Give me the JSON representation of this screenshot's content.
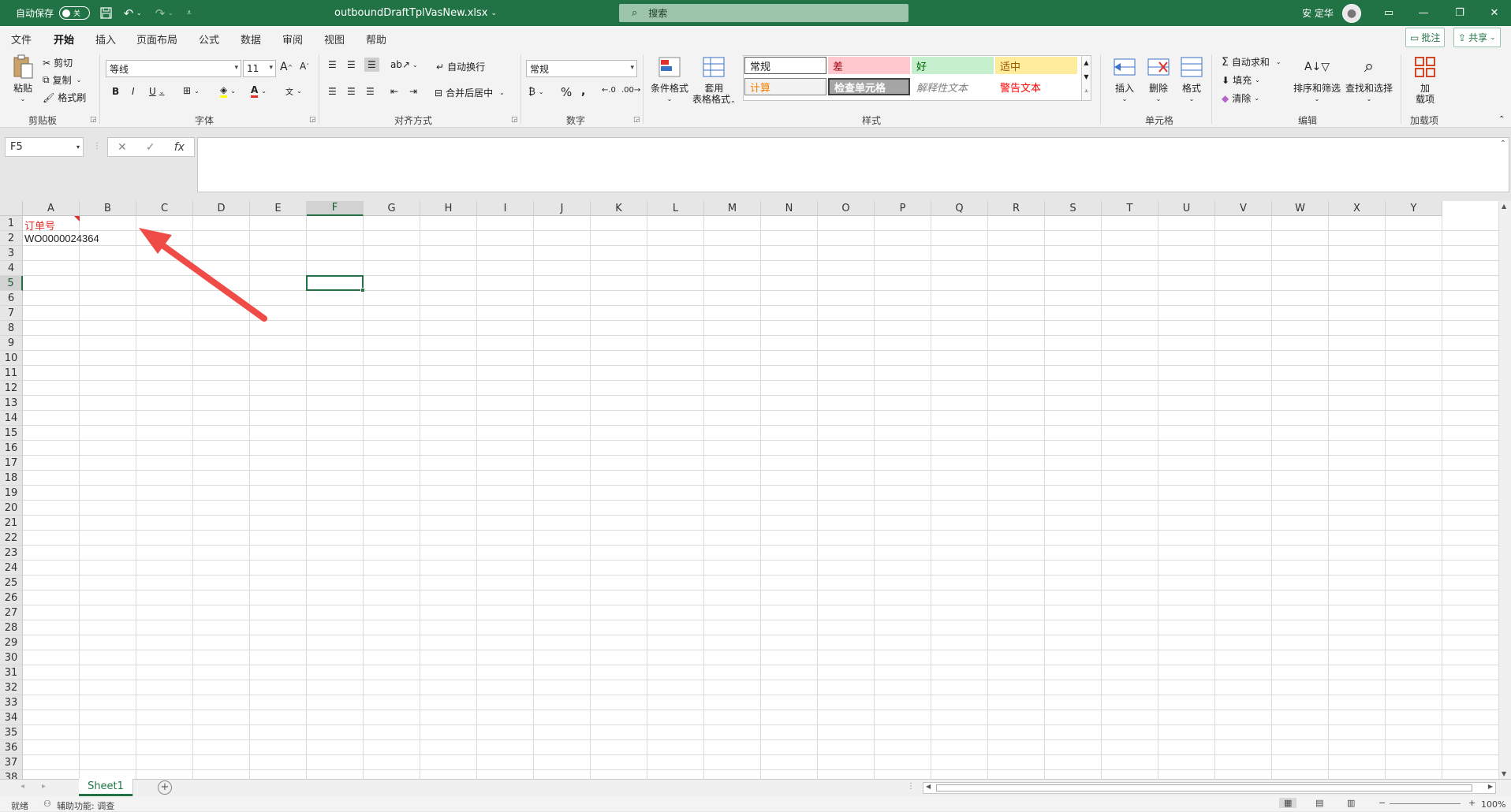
{
  "titlebar": {
    "autosave_label": "自动保存",
    "autosave_state": "关",
    "document_title": "outboundDraftTplVasNew.xlsx",
    "search_placeholder": "搜索",
    "user_name": "安 定华"
  },
  "ribbon_tabs": [
    "文件",
    "开始",
    "插入",
    "页面布局",
    "公式",
    "数据",
    "审阅",
    "视图",
    "帮助"
  ],
  "ribbon_actions": {
    "comments": "批注",
    "share": "共享"
  },
  "clipboard": {
    "paste": "粘贴",
    "cut": "剪切",
    "copy": "复制",
    "format_painter": "格式刷",
    "label": "剪贴板"
  },
  "font": {
    "name": "等线",
    "size": "11",
    "label": "字体"
  },
  "alignment": {
    "wrap_text": "自动换行",
    "merge_center": "合并后居中",
    "label": "对齐方式"
  },
  "number": {
    "format": "常规",
    "label": "数字"
  },
  "styles": {
    "conditional_format": "条件格式",
    "format_as_table_1": "套用",
    "format_as_table_2": "表格格式",
    "cells": [
      "常规",
      "差",
      "好",
      "适中",
      "计算",
      "检查单元格",
      "解释性文本",
      "警告文本"
    ],
    "label": "样式"
  },
  "cells_group": {
    "insert": "插入",
    "delete": "删除",
    "format": "格式",
    "label": "单元格"
  },
  "editing": {
    "autosum": "自动求和",
    "fill": "填充",
    "clear": "清除",
    "sort_filter": "排序和筛选",
    "find_select": "查找和选择",
    "label": "编辑"
  },
  "addins": {
    "addin_1": "加",
    "addin_2": "载项",
    "label": "加载项"
  },
  "formula_bar": {
    "name_box": "F5",
    "fx": "fx"
  },
  "columns": [
    "A",
    "B",
    "C",
    "D",
    "E",
    "F",
    "G",
    "H",
    "I",
    "J",
    "K",
    "L",
    "M",
    "N",
    "O",
    "P",
    "Q",
    "R",
    "S",
    "T",
    "U",
    "V",
    "W",
    "X",
    "Y"
  ],
  "rows": [
    "1",
    "2",
    "3",
    "4",
    "5",
    "6",
    "7",
    "8",
    "9",
    "10",
    "11",
    "12",
    "13",
    "14",
    "15",
    "16",
    "17",
    "18",
    "19",
    "20",
    "21",
    "22",
    "23",
    "24",
    "25",
    "26",
    "27",
    "28",
    "29",
    "30",
    "31",
    "32",
    "33",
    "34",
    "35",
    "36",
    "37",
    "38"
  ],
  "cells": {
    "A1": "订单号",
    "A2": "WO0000024364"
  },
  "selected_cell": "F5",
  "sheet": {
    "tab_name": "Sheet1",
    "add": "+"
  },
  "status": {
    "ready": "就绪",
    "accessibility": "辅助功能: 调查",
    "zoom": "100%"
  },
  "colors": {
    "excel_green": "#217346",
    "header_red": "#e0302a",
    "arrow": "#ef4b47"
  }
}
